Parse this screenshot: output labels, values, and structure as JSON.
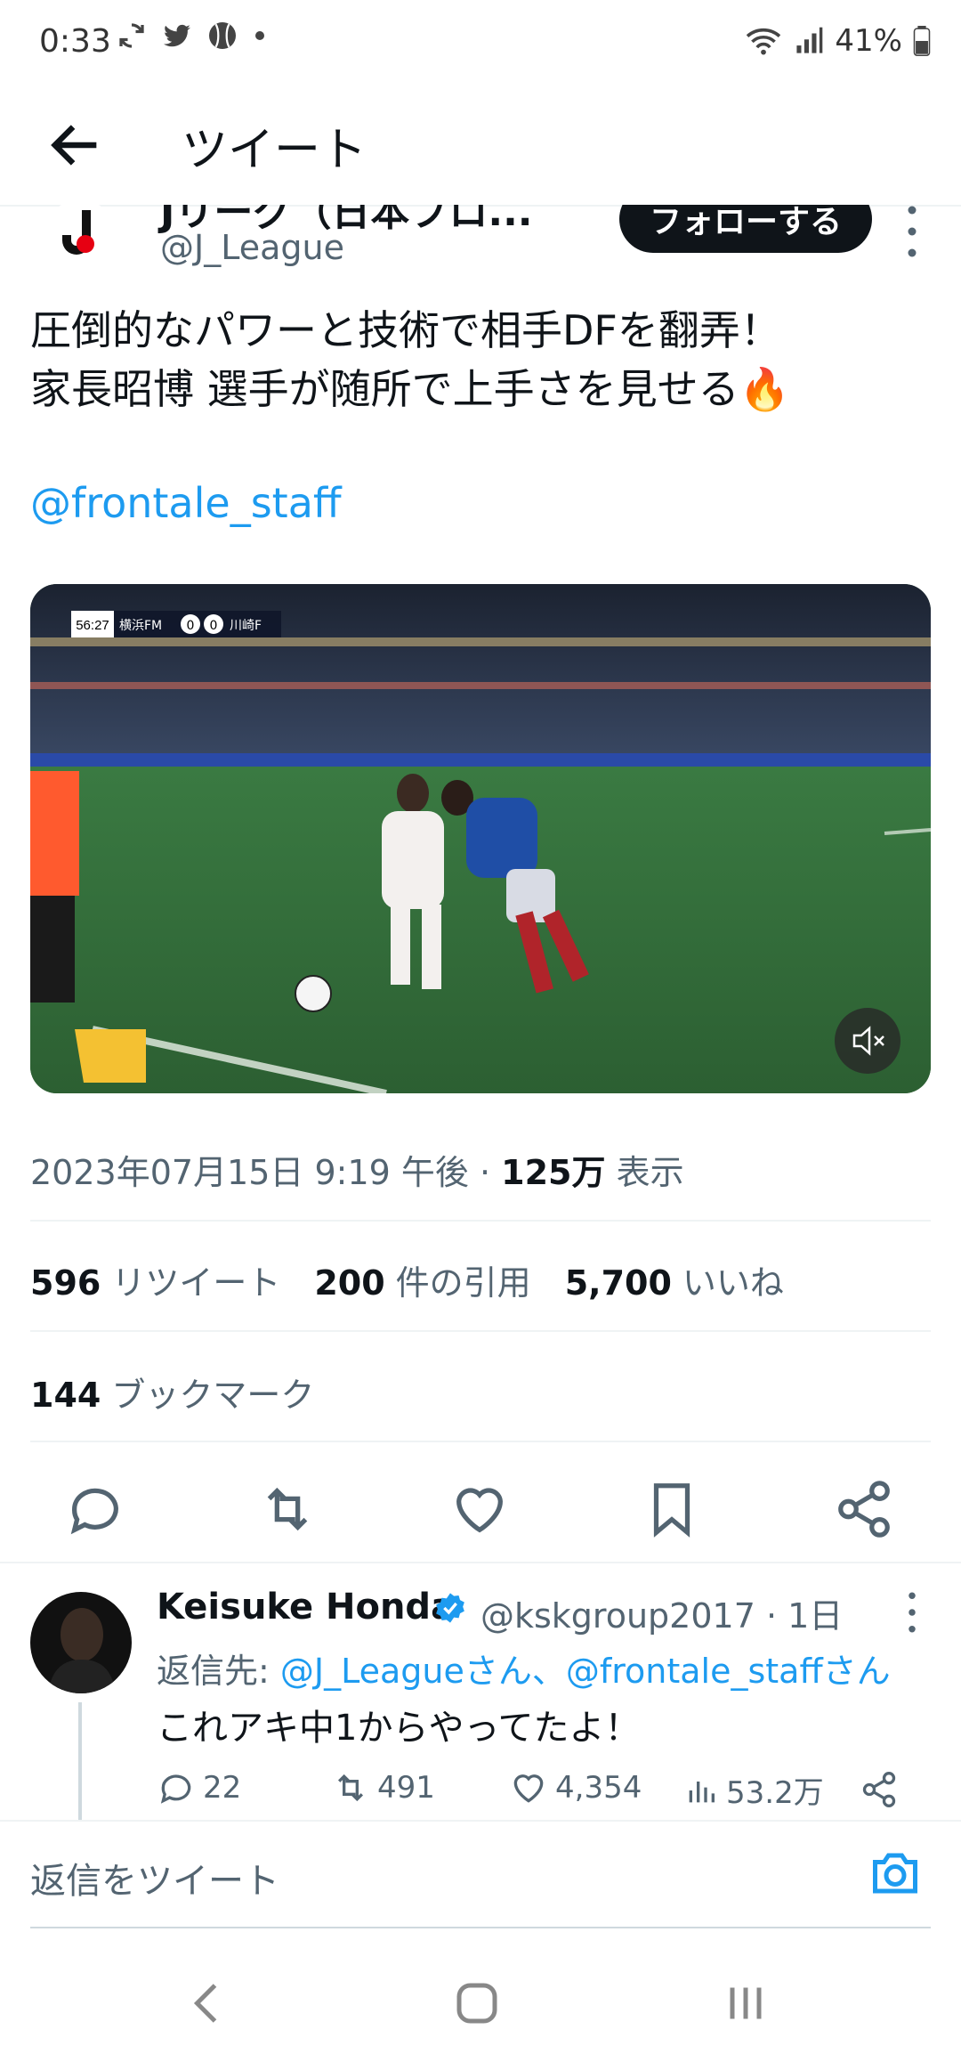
{
  "status_bar": {
    "time": "0:33",
    "battery": "41%"
  },
  "header": {
    "title": "ツイート"
  },
  "author": {
    "display_name": "Jリーグ（日本プロ...",
    "handle": "@J_League",
    "follow_label": "フォローする"
  },
  "tweet": {
    "text": "圧倒的なパワーと技術で相手DFを翻弄！\n家長昭博 選手が随所で上手さを見せる🔥",
    "mention": "@frontale_staff",
    "scoreboard": {
      "time": "56:27",
      "home": "横浜FM",
      "score_home": "0",
      "score_away": "0",
      "away": "川崎F"
    },
    "timestamp": "2023年07月15日 9:19 午後 · ",
    "views_count": "125万",
    "views_label": " 表示"
  },
  "stats": {
    "retweets": "596",
    "retweets_label": "リツイート",
    "quotes": "200",
    "quotes_label": "件の引用",
    "likes": "5,700",
    "likes_label": "いいね",
    "bookmarks": "144",
    "bookmarks_label": "ブックマーク"
  },
  "reply": {
    "name": "Keisuke Honda",
    "handle_time": "@kskgroup2017 · 1日",
    "reply_to_prefix": "返信先: ",
    "reply_to_links": "@J_Leagueさん、@frontale_staffさん",
    "text": "これアキ中1からやってたよ！",
    "replies": "22",
    "retweets": "491",
    "likes": "4,354",
    "views": "53.2万"
  },
  "compose": {
    "placeholder": "返信をツイート"
  },
  "colors": {
    "accent": "#1d9bf0",
    "text": "#0f1419",
    "muted": "#536471"
  }
}
